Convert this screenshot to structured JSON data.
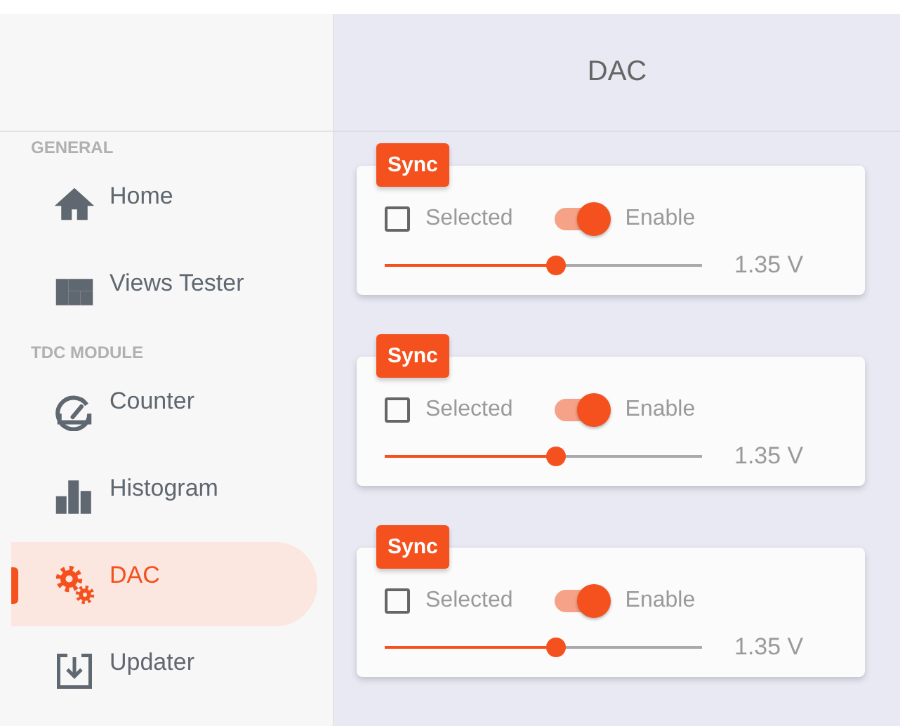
{
  "sidebar": {
    "sections": [
      {
        "label": "GENERAL",
        "items": [
          {
            "label": "Home",
            "kind": "home",
            "selected": false
          },
          {
            "label": "Views Tester",
            "kind": "views",
            "selected": false
          }
        ]
      },
      {
        "label": "TDC MODULE",
        "items": [
          {
            "label": "Counter",
            "kind": "gauge",
            "selected": false
          },
          {
            "label": "Histogram",
            "kind": "bars",
            "selected": false
          },
          {
            "label": "DAC",
            "kind": "gears",
            "selected": true
          },
          {
            "label": "Updater",
            "kind": "download",
            "selected": false
          }
        ]
      }
    ]
  },
  "header": {
    "title": "DAC"
  },
  "channels": [
    {
      "sync": "Sync",
      "selected_label": "Selected",
      "checked": false,
      "enable_label": "Enable",
      "on": true,
      "level": 0.54,
      "reading": "1.35 V"
    },
    {
      "sync": "Sync",
      "selected_label": "Selected",
      "checked": false,
      "enable_label": "Enable",
      "on": true,
      "level": 0.54,
      "reading": "1.35 V"
    },
    {
      "sync": "Sync",
      "selected_label": "Selected",
      "checked": false,
      "enable_label": "Enable",
      "on": true,
      "level": 0.54,
      "reading": "1.35 V"
    }
  ]
}
